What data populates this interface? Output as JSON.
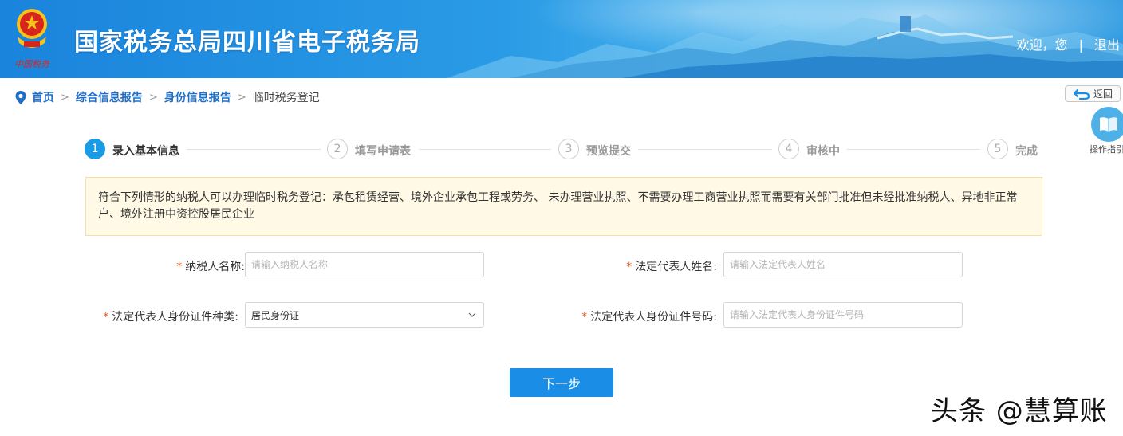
{
  "header": {
    "emblem_caption": "中国税务",
    "title": "国家税务总局四川省电子税务局",
    "welcome": "欢迎，您",
    "separator": "|",
    "logout": "退出"
  },
  "breadcrumb": {
    "items": [
      "首页",
      "综合信息报告",
      "身份信息报告"
    ],
    "separator": ">",
    "current": "临时税务登记"
  },
  "back_button": {
    "label": "返回"
  },
  "guide": {
    "label": "操作指引"
  },
  "steps": [
    {
      "number": "1",
      "label": "录入基本信息",
      "active": true
    },
    {
      "number": "2",
      "label": "填写申请表",
      "active": false
    },
    {
      "number": "3",
      "label": "预览提交",
      "active": false
    },
    {
      "number": "4",
      "label": "审核中",
      "active": false
    },
    {
      "number": "5",
      "label": "完成",
      "active": false
    }
  ],
  "notice": {
    "text": "符合下列情形的纳税人可以办理临时税务登记：承包租赁经营、境外企业承包工程或劳务、 未办理营业执照、不需要办理工商营业执照而需要有关部门批准但未经批准纳税人、异地非正常户、境外注册中资控股居民企业"
  },
  "form": {
    "required_mark": "*",
    "taxpayer_name": {
      "label": "纳税人名称:",
      "placeholder": "请输入纳税人名称",
      "value": ""
    },
    "legal_rep_name": {
      "label": "法定代表人姓名:",
      "placeholder": "请输入法定代表人姓名",
      "value": ""
    },
    "id_type": {
      "label": "法定代表人身份证件种类:",
      "selected": "居民身份证"
    },
    "id_number": {
      "label": "法定代表人身份证件号码:",
      "placeholder": "请输入法定代表人身份证件号码",
      "value": ""
    }
  },
  "next_button": {
    "label": "下一步"
  },
  "watermark": "头条 @慧算账",
  "colors": {
    "primary": "#1a8ee6",
    "active_step": "#1a9be6",
    "link": "#1f6fc6",
    "required": "#e8561c",
    "notice_bg": "#fff9e6"
  }
}
